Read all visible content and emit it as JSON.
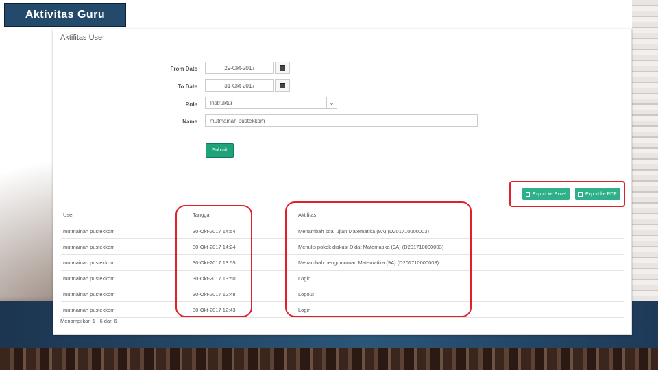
{
  "slide": {
    "title": "Aktivitas Guru"
  },
  "panel": {
    "title": "Aktifitas User"
  },
  "form": {
    "from_date": {
      "label": "From Date",
      "value": "29-Okt-2017"
    },
    "to_date": {
      "label": "To Date",
      "value": "31-Okt-2017"
    },
    "role": {
      "label": "Role",
      "value": "Instruktur"
    },
    "name": {
      "label": "Name",
      "value": "mutmainah pustekkom"
    },
    "submit_label": "Submit"
  },
  "export": {
    "excel_label": "Export ke Excel",
    "pdf_label": "Export ke PDF"
  },
  "table": {
    "headers": {
      "user": "User",
      "date": "Tanggal",
      "activity": "Aktifitas"
    },
    "rows": [
      {
        "user": "mutmainah pustekkom",
        "date": "30-Okt-2017 14:54",
        "activity": "Menambah soal ujian Matematika (9A) (D201710000003)"
      },
      {
        "user": "mutmainah pustekkom",
        "date": "30-Okt-2017 14:24",
        "activity": "Menulis pokok diskusi Didat Matematika (9A) (D201710000003)"
      },
      {
        "user": "mutmainah pustekkom",
        "date": "30-Okt-2017 13:55",
        "activity": "Menambah pengumuman Matematika (9A) (D201710000003)"
      },
      {
        "user": "mutmainah pustekkom",
        "date": "30-Okt-2017 13:50",
        "activity": "Login"
      },
      {
        "user": "mutmainah pustekkom",
        "date": "30-Okt-2017 12:48",
        "activity": "Logout"
      },
      {
        "user": "mutmainah pustekkom",
        "date": "30-Okt-2017 12:43",
        "activity": "Login"
      }
    ],
    "footer": "Menampilkan 1 - 6 dari 6"
  },
  "colors": {
    "accent": "#1fa37a",
    "highlight": "#e0202a",
    "header_bg": "#23496b"
  },
  "icons": {
    "calendar": "calendar-icon",
    "export": "document-icon",
    "dropdown": "chevron-down-icon"
  }
}
